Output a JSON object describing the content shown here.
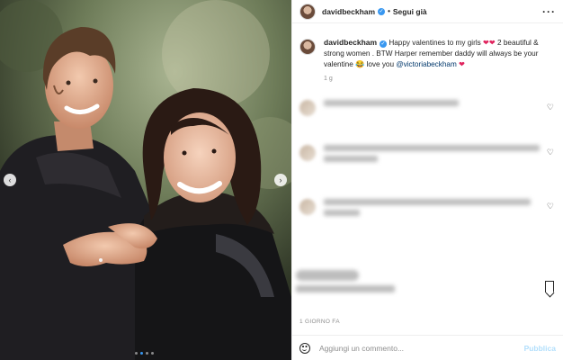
{
  "header": {
    "username": "davidbeckham",
    "separator": "•",
    "follow_label": "Segui già",
    "more_icon": "more-horizontal-icon"
  },
  "caption": {
    "username": "davidbeckham",
    "text_part1": "Happy valentines to my girls",
    "hearts": "❤❤",
    "text_part2": "2 beautiful & strong women . BTW Harper remember daddy will always be your valentine",
    "laugh_emoji": "😂",
    "text_part3": "love you",
    "mention": "@victoriabeckham",
    "end_heart": "❤",
    "time": "1 g"
  },
  "colors": {
    "verified": "#3897f0",
    "heart": "#e0245e",
    "mention": "#00376b",
    "post_button": "#b2dffc"
  },
  "media": {
    "nav_left_icon": "chevron-left-icon",
    "nav_right_icon": "chevron-right-icon",
    "prev_glyph": "‹",
    "next_glyph": "›",
    "carousel_position": 1,
    "carousel_count": 4
  },
  "actions": {
    "save_icon": "bookmark-icon",
    "date": "1 GIORNO FA"
  },
  "comment_box": {
    "placeholder": "Aggiungi un commento...",
    "post_label": "Pubblica"
  }
}
